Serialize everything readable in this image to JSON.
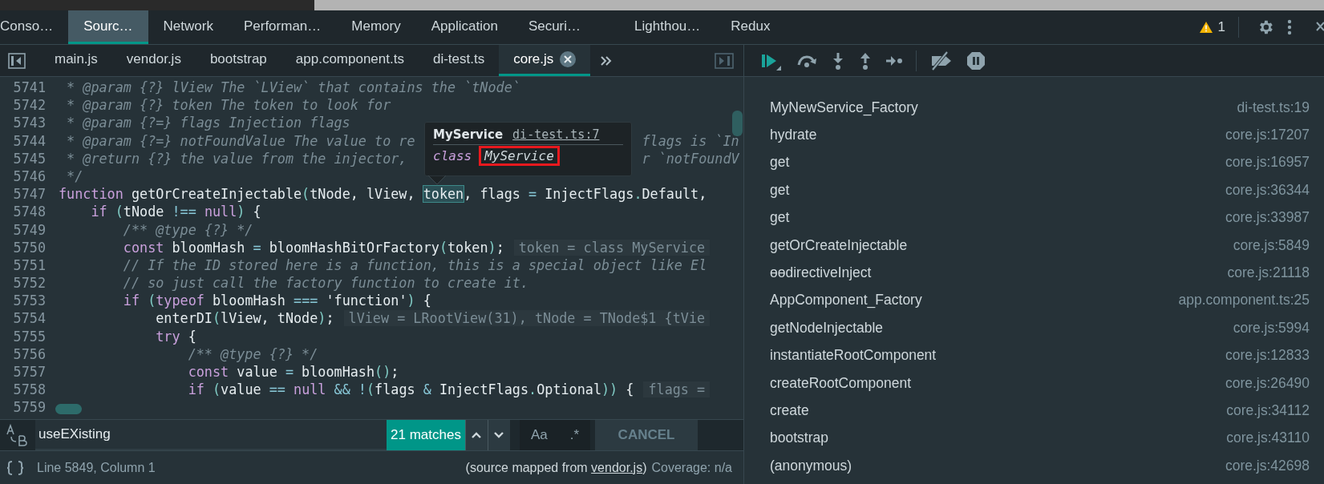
{
  "top_tabs": [
    {
      "label": "Conso…",
      "selected": false
    },
    {
      "label": "Sourc…",
      "selected": true
    },
    {
      "label": "Network",
      "selected": false
    },
    {
      "label": "Performan…",
      "selected": false
    },
    {
      "label": "Memory",
      "selected": false
    },
    {
      "label": "Application",
      "selected": false
    },
    {
      "label": "Securi…",
      "selected": false
    },
    {
      "label": "Lighthou…",
      "selected": false
    },
    {
      "label": "Redux",
      "selected": false
    }
  ],
  "warnings": {
    "count": "1"
  },
  "file_tabs": [
    {
      "label": "main.js",
      "selected": false
    },
    {
      "label": "vendor.js",
      "selected": false
    },
    {
      "label": "bootstrap",
      "selected": false
    },
    {
      "label": "app.component.ts",
      "selected": false
    },
    {
      "label": "di-test.ts",
      "selected": false
    },
    {
      "label": "core.js",
      "selected": true
    }
  ],
  "code": {
    "lines": [
      {
        "number": "5741",
        "tokens": [
          {
            "kind": "comment",
            "text": " * @param {?} lView The `LView` that contains the `tNode`"
          }
        ]
      },
      {
        "number": "5742",
        "tokens": [
          {
            "kind": "comment",
            "text": " * @param {?} token The token to look for"
          }
        ]
      },
      {
        "number": "5743",
        "tokens": [
          {
            "kind": "comment",
            "text": " * @param {?=} flags Injection flags"
          }
        ]
      },
      {
        "number": "5744",
        "tokens": [
          {
            "kind": "comment",
            "text": " * @param {?=} notFoundValue The value to re"
          },
          {
            "kind": "comment",
            "text": "flags is `In",
            "after_popup": true
          }
        ]
      },
      {
        "number": "5745",
        "tokens": [
          {
            "kind": "comment",
            "text": " * @return {?} the value from the injector,"
          },
          {
            "kind": "comment",
            "text": "r `notFoundV",
            "after_popup": true
          }
        ]
      },
      {
        "number": "5746",
        "tokens": [
          {
            "kind": "comment",
            "text": " */"
          }
        ]
      },
      {
        "number": "5747",
        "tokens": [
          {
            "kind": "kw",
            "text": "function"
          },
          {
            "kind": "plain",
            "text": " getOrCreateInjectable"
          },
          {
            "kind": "punct",
            "text": "("
          },
          {
            "kind": "plain",
            "text": "tNode, lView, "
          },
          {
            "kind": "match",
            "text": "token"
          },
          {
            "kind": "plain",
            "text": ", flags "
          },
          {
            "kind": "op",
            "text": "="
          },
          {
            "kind": "plain",
            "text": " InjectFlags"
          },
          {
            "kind": "punct",
            "text": "."
          },
          {
            "kind": "plain",
            "text": "Default,"
          }
        ]
      },
      {
        "number": "5748",
        "tokens": [
          {
            "kind": "kw",
            "text": "    if"
          },
          {
            "kind": "punct",
            "text": " ("
          },
          {
            "kind": "plain",
            "text": "tNode "
          },
          {
            "kind": "op",
            "text": "!=="
          },
          {
            "kind": "kw",
            "text": " null"
          },
          {
            "kind": "punct",
            "text": ")"
          },
          {
            "kind": "plain",
            "text": " {"
          }
        ]
      },
      {
        "number": "5749",
        "tokens": [
          {
            "kind": "comment",
            "text": "        /** @type {?} */"
          }
        ]
      },
      {
        "number": "5750",
        "tokens": [
          {
            "kind": "kw",
            "text": "        const"
          },
          {
            "kind": "plain",
            "text": " bloomHash "
          },
          {
            "kind": "op",
            "text": "="
          },
          {
            "kind": "plain",
            "text": " bloomHashBitOrFactory"
          },
          {
            "kind": "punct",
            "text": "("
          },
          {
            "kind": "plain",
            "text": "token"
          },
          {
            "kind": "punct",
            "text": ")"
          },
          {
            "kind": "plain",
            "text": ";"
          }
        ],
        "hint": "token = class MyService"
      },
      {
        "number": "5751",
        "tokens": [
          {
            "kind": "comment",
            "text": "        // If the ID stored here is a function, this is a special object like El"
          }
        ]
      },
      {
        "number": "5752",
        "tokens": [
          {
            "kind": "comment",
            "text": "        // so just call the factory function to create it."
          }
        ]
      },
      {
        "number": "5753",
        "tokens": [
          {
            "kind": "kw",
            "text": "        if"
          },
          {
            "kind": "punct",
            "text": " ("
          },
          {
            "kind": "kw",
            "text": "typeof"
          },
          {
            "kind": "plain",
            "text": " bloomHash "
          },
          {
            "kind": "op",
            "text": "==="
          },
          {
            "kind": "plain",
            "text": " 'function'"
          },
          {
            "kind": "punct",
            "text": ")"
          },
          {
            "kind": "plain",
            "text": " {"
          }
        ]
      },
      {
        "number": "5754",
        "tokens": [
          {
            "kind": "plain",
            "text": "            enterDI"
          },
          {
            "kind": "punct",
            "text": "("
          },
          {
            "kind": "plain",
            "text": "lView, tNode"
          },
          {
            "kind": "punct",
            "text": ")"
          },
          {
            "kind": "plain",
            "text": ";"
          }
        ],
        "hint": "lView = LRootView(31), tNode = TNode$1 {tVie"
      },
      {
        "number": "5755",
        "tokens": [
          {
            "kind": "kw",
            "text": "            try"
          },
          {
            "kind": "plain",
            "text": " {"
          }
        ]
      },
      {
        "number": "5756",
        "tokens": [
          {
            "kind": "comment",
            "text": "                /** @type {?} */"
          }
        ]
      },
      {
        "number": "5757",
        "tokens": [
          {
            "kind": "kw",
            "text": "                const"
          },
          {
            "kind": "plain",
            "text": " value "
          },
          {
            "kind": "op",
            "text": "="
          },
          {
            "kind": "plain",
            "text": " bloomHash"
          },
          {
            "kind": "punct",
            "text": "()"
          },
          {
            "kind": "plain",
            "text": ";"
          }
        ]
      },
      {
        "number": "5758",
        "tokens": [
          {
            "kind": "kw",
            "text": "                if"
          },
          {
            "kind": "punct",
            "text": " ("
          },
          {
            "kind": "plain",
            "text": "value "
          },
          {
            "kind": "op",
            "text": "=="
          },
          {
            "kind": "kw",
            "text": " null"
          },
          {
            "kind": "op",
            "text": " && !"
          },
          {
            "kind": "punct",
            "text": "("
          },
          {
            "kind": "plain",
            "text": "flags "
          },
          {
            "kind": "op",
            "text": "&"
          },
          {
            "kind": "plain",
            "text": " InjectFlags"
          },
          {
            "kind": "punct",
            "text": "."
          },
          {
            "kind": "plain",
            "text": "Optional"
          },
          {
            "kind": "punct",
            "text": "))"
          },
          {
            "kind": "plain",
            "text": " {"
          }
        ],
        "hint": "flags ="
      },
      {
        "number": "5759"
      }
    ]
  },
  "popup": {
    "title": "MyService",
    "source": "di-test.ts:7",
    "body": [
      {
        "kind": "kw",
        "text": "class"
      },
      {
        "kind": "name",
        "text": "MyService",
        "boxed": true
      }
    ]
  },
  "search": {
    "value": "useEXisting",
    "matches": "21 matches",
    "case_label": "Aa",
    "regex_label": ".*",
    "cancel": "CANCEL"
  },
  "status": {
    "position": "Line 5849, Column 1",
    "source_prefix": "(source mapped from ",
    "source_link": "vendor.js",
    "source_suffix": ")",
    "coverage": "Coverage: n/a"
  },
  "call_stack": [
    {
      "function": "MyNewService_Factory",
      "location": "di-test.ts:19"
    },
    {
      "function": "hydrate",
      "location": "core.js:17207"
    },
    {
      "function": "get",
      "location": "core.js:16957"
    },
    {
      "function": "get",
      "location": "core.js:36344"
    },
    {
      "function": "get",
      "location": "core.js:33987"
    },
    {
      "function": "getOrCreateInjectable",
      "location": "core.js:5849"
    },
    {
      "function": "ɵɵdirectiveInject",
      "location": "core.js:21118"
    },
    {
      "function": "AppComponent_Factory",
      "location": "app.component.ts:25"
    },
    {
      "function": "getNodeInjectable",
      "location": "core.js:5994"
    },
    {
      "function": "instantiateRootComponent",
      "location": "core.js:12833"
    },
    {
      "function": "createRootComponent",
      "location": "core.js:26490"
    },
    {
      "function": "create",
      "location": "core.js:34112"
    },
    {
      "function": "bootstrap",
      "location": "core.js:43110"
    },
    {
      "function": "(anonymous)",
      "location": "core.js:42698"
    }
  ]
}
